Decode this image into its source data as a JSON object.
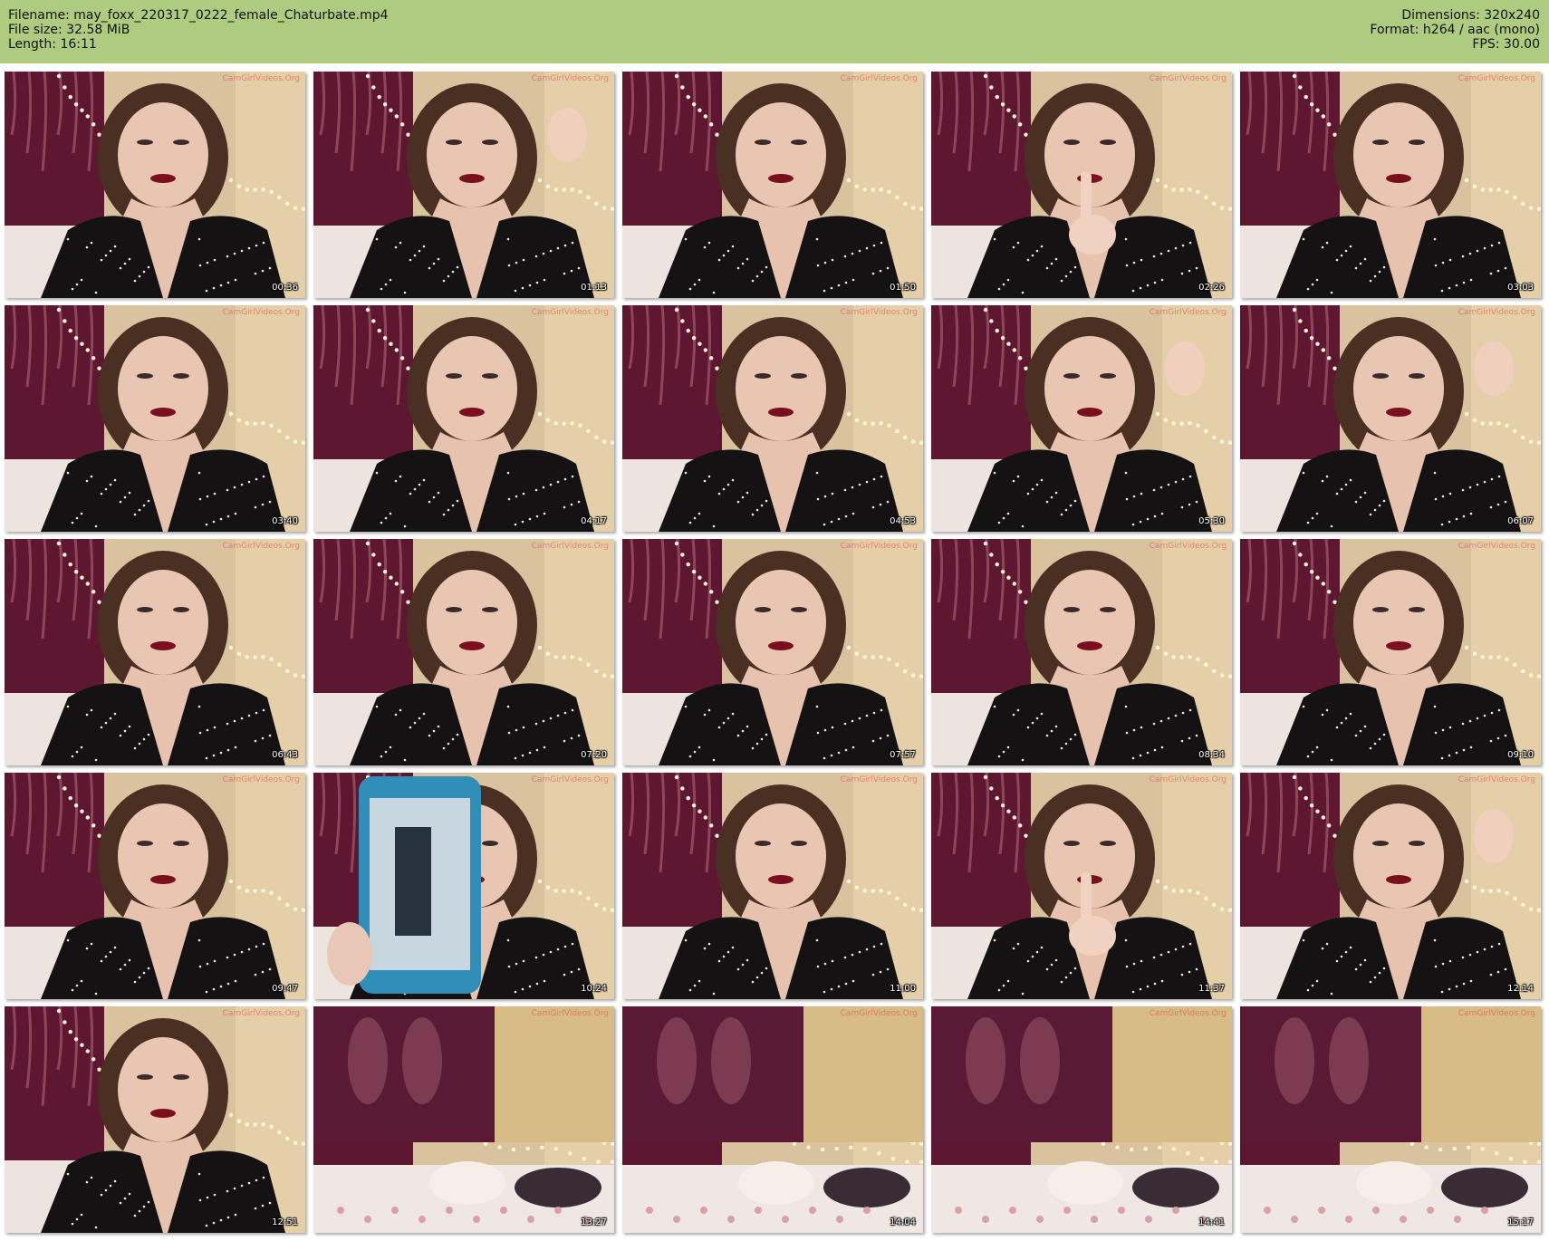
{
  "header": {
    "filename_line": "Filename: may_foxx_220317_0222_female_Chaturbate.mp4",
    "filesize_line": "File size: 32.58 MiB",
    "length_line": "Length: 16:11",
    "dimensions_line": "Dimensions: 320x240",
    "format_line": "Format: h264 / aac (mono)",
    "fps_line": "FPS: 30.00",
    "background_color": "#aecb80"
  },
  "watermark": "CamGirlVideos.Org",
  "thumbnails": [
    {
      "time": "00:36",
      "scene": "face-wide"
    },
    {
      "time": "01:13",
      "scene": "face-hand"
    },
    {
      "time": "01:50",
      "scene": "face-wide"
    },
    {
      "time": "02:26",
      "scene": "finger-mouth"
    },
    {
      "time": "03:03",
      "scene": "face-down"
    },
    {
      "time": "03:40",
      "scene": "face-down"
    },
    {
      "time": "04:17",
      "scene": "face-wide"
    },
    {
      "time": "04:53",
      "scene": "face-wide"
    },
    {
      "time": "05:30",
      "scene": "face-hand"
    },
    {
      "time": "06:07",
      "scene": "face-hand"
    },
    {
      "time": "06:43",
      "scene": "face-wide"
    },
    {
      "time": "07:20",
      "scene": "face-wide"
    },
    {
      "time": "07:57",
      "scene": "face-wide"
    },
    {
      "time": "08:34",
      "scene": "face-wide"
    },
    {
      "time": "09:10",
      "scene": "face-wide"
    },
    {
      "time": "09:47",
      "scene": "face-wide"
    },
    {
      "time": "10:24",
      "scene": "phone"
    },
    {
      "time": "11:00",
      "scene": "face-wide"
    },
    {
      "time": "11:37",
      "scene": "finger-mouth"
    },
    {
      "time": "12:14",
      "scene": "face-hand"
    },
    {
      "time": "12:51",
      "scene": "face-wide"
    },
    {
      "time": "13:27",
      "scene": "empty-room"
    },
    {
      "time": "14:04",
      "scene": "empty-room"
    },
    {
      "time": "14:41",
      "scene": "empty-room"
    },
    {
      "time": "15:17",
      "scene": "empty-room"
    }
  ]
}
